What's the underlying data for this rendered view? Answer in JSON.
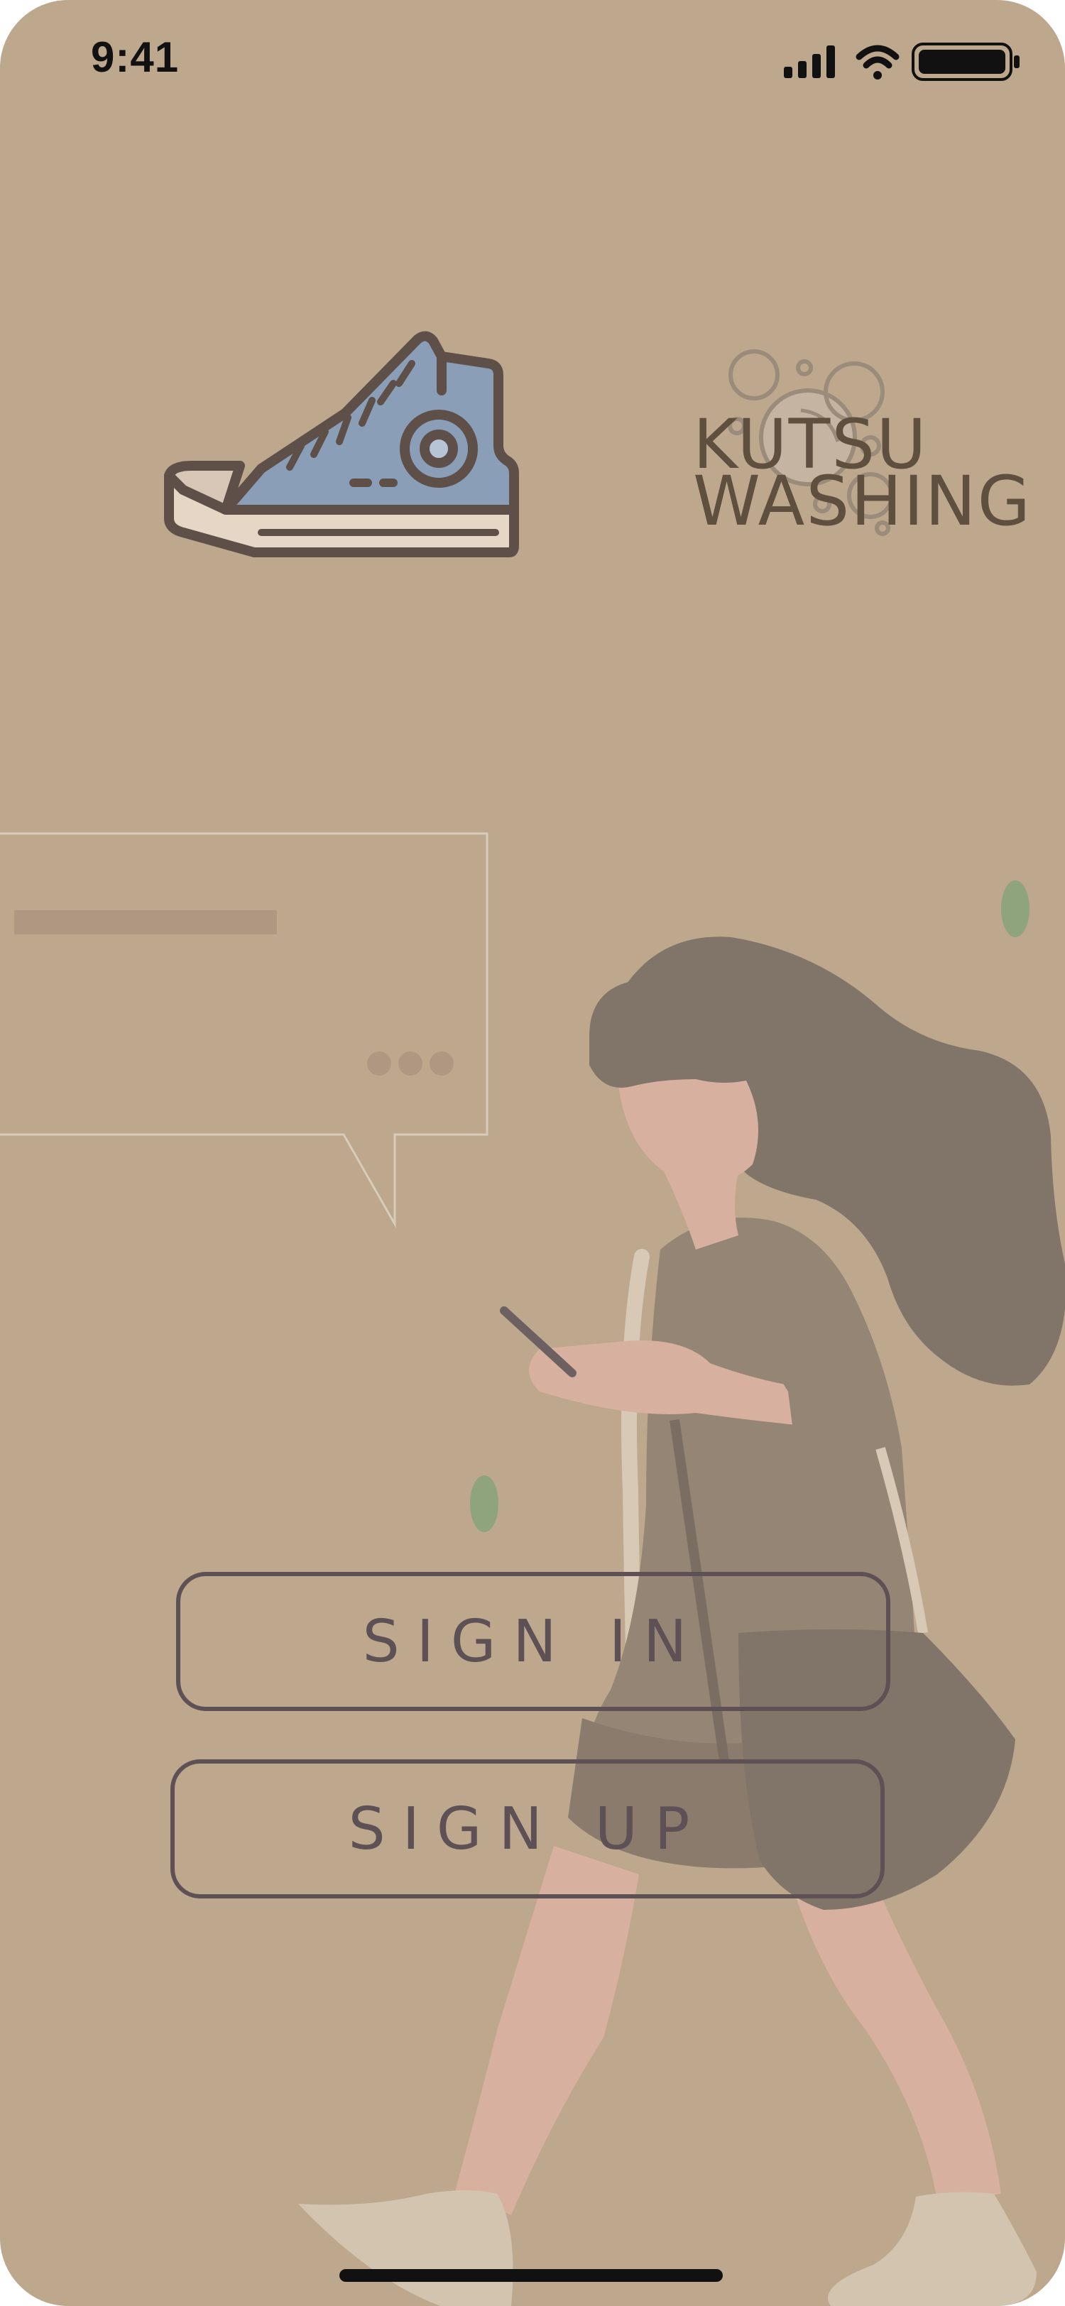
{
  "status_bar": {
    "time": "9:41",
    "icons": [
      "signal-icon",
      "wifi-icon",
      "battery-icon"
    ]
  },
  "logo": {
    "line1": "KUTSU",
    "line2": "WASHING",
    "icon": "sneaker-icon",
    "decoration": "bubbles-icon"
  },
  "actions": {
    "sign_in_label": "SIGN IN",
    "sign_up_label": "SIGN UP"
  },
  "colors": {
    "background": "#bda78d",
    "text_dark": "#5e5156",
    "logo_text": "#5f4f3f"
  }
}
